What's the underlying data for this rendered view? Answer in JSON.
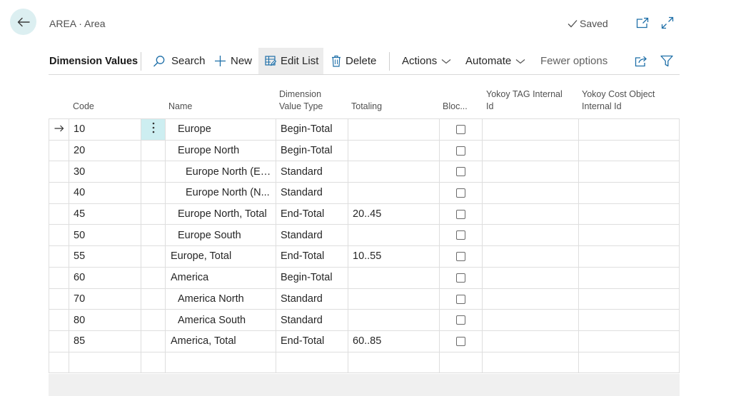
{
  "header": {
    "breadcrumb": "AREA · Area",
    "saved_label": "Saved"
  },
  "actionbar": {
    "title": "Dimension Values",
    "search": "Search",
    "new": "New",
    "edit_list": "Edit List",
    "delete": "Delete",
    "actions": "Actions",
    "automate": "Automate",
    "fewer_options": "Fewer options"
  },
  "columns": {
    "code": "Code",
    "name": "Name",
    "type_1": "Dimension",
    "type_2": "Value Type",
    "totaling": "Totaling",
    "blocked": "Bloc...",
    "tag_1": "Yokoy TAG Internal",
    "tag_2": "Id",
    "cost_1": "Yokoy Cost Object",
    "cost_2": "Internal Id"
  },
  "rows": [
    {
      "code": "10",
      "name": "Europe",
      "indent": 1,
      "type": "Begin-Total",
      "totaling": "",
      "blocked": false,
      "current": true
    },
    {
      "code": "20",
      "name": "Europe North",
      "indent": 1,
      "type": "Begin-Total",
      "totaling": "",
      "blocked": false
    },
    {
      "code": "30",
      "name": "Europe North (EU)",
      "indent": 2,
      "type": "Standard",
      "totaling": "",
      "blocked": false
    },
    {
      "code": "40",
      "name": "Europe North (N...",
      "indent": 2,
      "type": "Standard",
      "totaling": "",
      "blocked": false
    },
    {
      "code": "45",
      "name": "Europe North, Total",
      "indent": 1,
      "type": "End-Total",
      "totaling": "20..45",
      "blocked": false
    },
    {
      "code": "50",
      "name": "Europe South",
      "indent": 1,
      "type": "Standard",
      "totaling": "",
      "blocked": false
    },
    {
      "code": "55",
      "name": "Europe, Total",
      "indent": 0,
      "type": "End-Total",
      "totaling": "10..55",
      "blocked": false
    },
    {
      "code": "60",
      "name": "America",
      "indent": 0,
      "type": "Begin-Total",
      "totaling": "",
      "blocked": false
    },
    {
      "code": "70",
      "name": "America North",
      "indent": 1,
      "type": "Standard",
      "totaling": "",
      "blocked": false
    },
    {
      "code": "80",
      "name": "America South",
      "indent": 1,
      "type": "Standard",
      "totaling": "",
      "blocked": false
    },
    {
      "code": "85",
      "name": "America, Total",
      "indent": 0,
      "type": "End-Total",
      "totaling": "60..85",
      "blocked": false
    }
  ],
  "icons": {
    "back": "arrow-left-icon",
    "saved": "checkmark-icon",
    "open_new_window": "open-in-new-window-icon",
    "expand": "expand-icon",
    "search": "search-icon",
    "new": "plus-icon",
    "edit_list": "edit-list-icon",
    "delete": "trash-icon",
    "share": "share-icon",
    "filter": "filter-icon",
    "current_row": "arrow-right-icon",
    "row_menu": "vertical-dots-icon"
  },
  "colors": {
    "accent": "#cdeef1",
    "back_button": "#dceff1"
  }
}
